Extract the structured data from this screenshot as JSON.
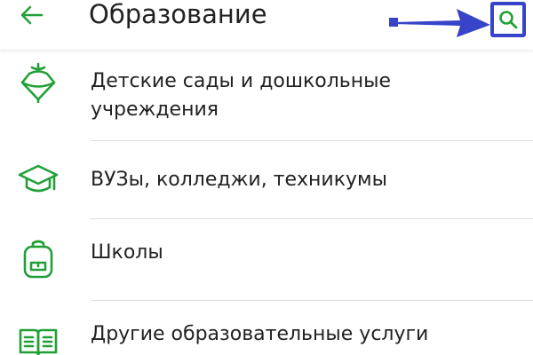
{
  "header": {
    "title": "Образование",
    "back_icon": "arrow-left-icon",
    "search_icon": "search-icon",
    "annotation_icon": "arrow-right-icon"
  },
  "colors": {
    "accent": "#21a038",
    "annotation": "#3743c8",
    "text": "#222222",
    "divider": "#dcdcdc"
  },
  "list": {
    "items": [
      {
        "label": "Детские сады и дошкольные учреждения",
        "icon": "spinning-top-icon"
      },
      {
        "label": "ВУЗы, колледжи, техникумы",
        "icon": "graduation-cap-icon"
      },
      {
        "label": "Школы",
        "icon": "backpack-icon"
      },
      {
        "label": "Другие образовательные услуги",
        "icon": "open-book-icon"
      }
    ]
  }
}
